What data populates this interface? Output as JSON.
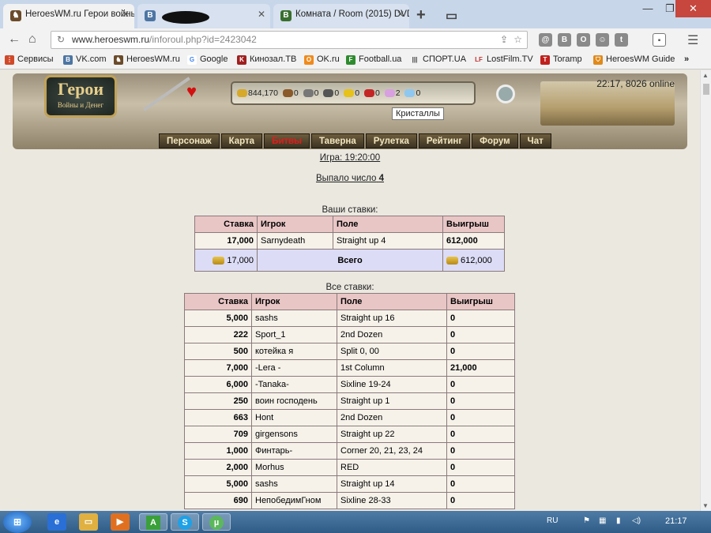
{
  "browser": {
    "tabs": [
      {
        "title": "HeroesWM.ru Герои войны",
        "active": true
      },
      {
        "title": "",
        "active": false
      },
      {
        "title": "Комната / Room (2015) DVD",
        "active": false
      }
    ],
    "url_host": "www.heroeswm.ru",
    "url_path": "/inforoul.php?id=2423042",
    "bookmarks": [
      "Сервисы",
      "VK.com",
      "HeroesWM.ru",
      "Google",
      "Кинозал.ТВ",
      "OK.ru",
      "Football.ua",
      "СПОРТ.UA",
      "LostFilm.TV",
      "Toramp",
      "HeroesWM Guide"
    ]
  },
  "header": {
    "logo_title": "Герои",
    "logo_subtitle": "Войны и Денег",
    "online": "22:17, 8026 online",
    "resources": [
      "844,170",
      "0",
      "0",
      "0",
      "0",
      "0",
      "2",
      "0"
    ],
    "tooltip": "Кристаллы",
    "menu": [
      "Персонаж",
      "Карта",
      "Битвы",
      "Таверна",
      "Рулетка",
      "Рейтинг",
      "Форум",
      "Чат"
    ]
  },
  "game": {
    "time_link": "Игра: 19:20:00",
    "result_label": "Выпало число",
    "result_number": "4"
  },
  "my_bets": {
    "caption": "Ваши ставки:",
    "headers": [
      "Ставка",
      "Игрок",
      "Поле",
      "Выигрыш"
    ],
    "rows": [
      [
        "17,000",
        "Sarnydeath",
        "Straight up 4",
        "612,000"
      ]
    ],
    "total_bet": "17,000",
    "total_label": "Всего",
    "total_win": "612,000"
  },
  "all_bets": {
    "caption": "Все ставки:",
    "headers": [
      "Ставка",
      "Игрок",
      "Поле",
      "Выигрыш"
    ],
    "rows": [
      [
        "5,000",
        "sashs",
        "Straight up 16",
        "0"
      ],
      [
        "222",
        "Sport_1",
        "2nd Dozen",
        "0"
      ],
      [
        "500",
        "котейка я",
        "Split 0, 00",
        "0"
      ],
      [
        "7,000",
        "-Lera -",
        "1st Column",
        "21,000"
      ],
      [
        "6,000",
        "-Tanaka-",
        "Sixline 19-24",
        "0"
      ],
      [
        "250",
        "воин господень",
        "Straight up 1",
        "0"
      ],
      [
        "663",
        "Hont",
        "2nd Dozen",
        "0"
      ],
      [
        "709",
        "girgensons",
        "Straight up 22",
        "0"
      ],
      [
        "1,000",
        "Финтарь-",
        "Corner 20, 21, 23, 24",
        "0"
      ],
      [
        "2,000",
        "Morhus",
        "RED",
        "0"
      ],
      [
        "5,000",
        "sashs",
        "Straight up 14",
        "0"
      ],
      [
        "690",
        "НепобедимГном",
        "Sixline 28-33",
        "0"
      ]
    ]
  },
  "taskbar": {
    "lang": "RU",
    "time": "21:17"
  }
}
